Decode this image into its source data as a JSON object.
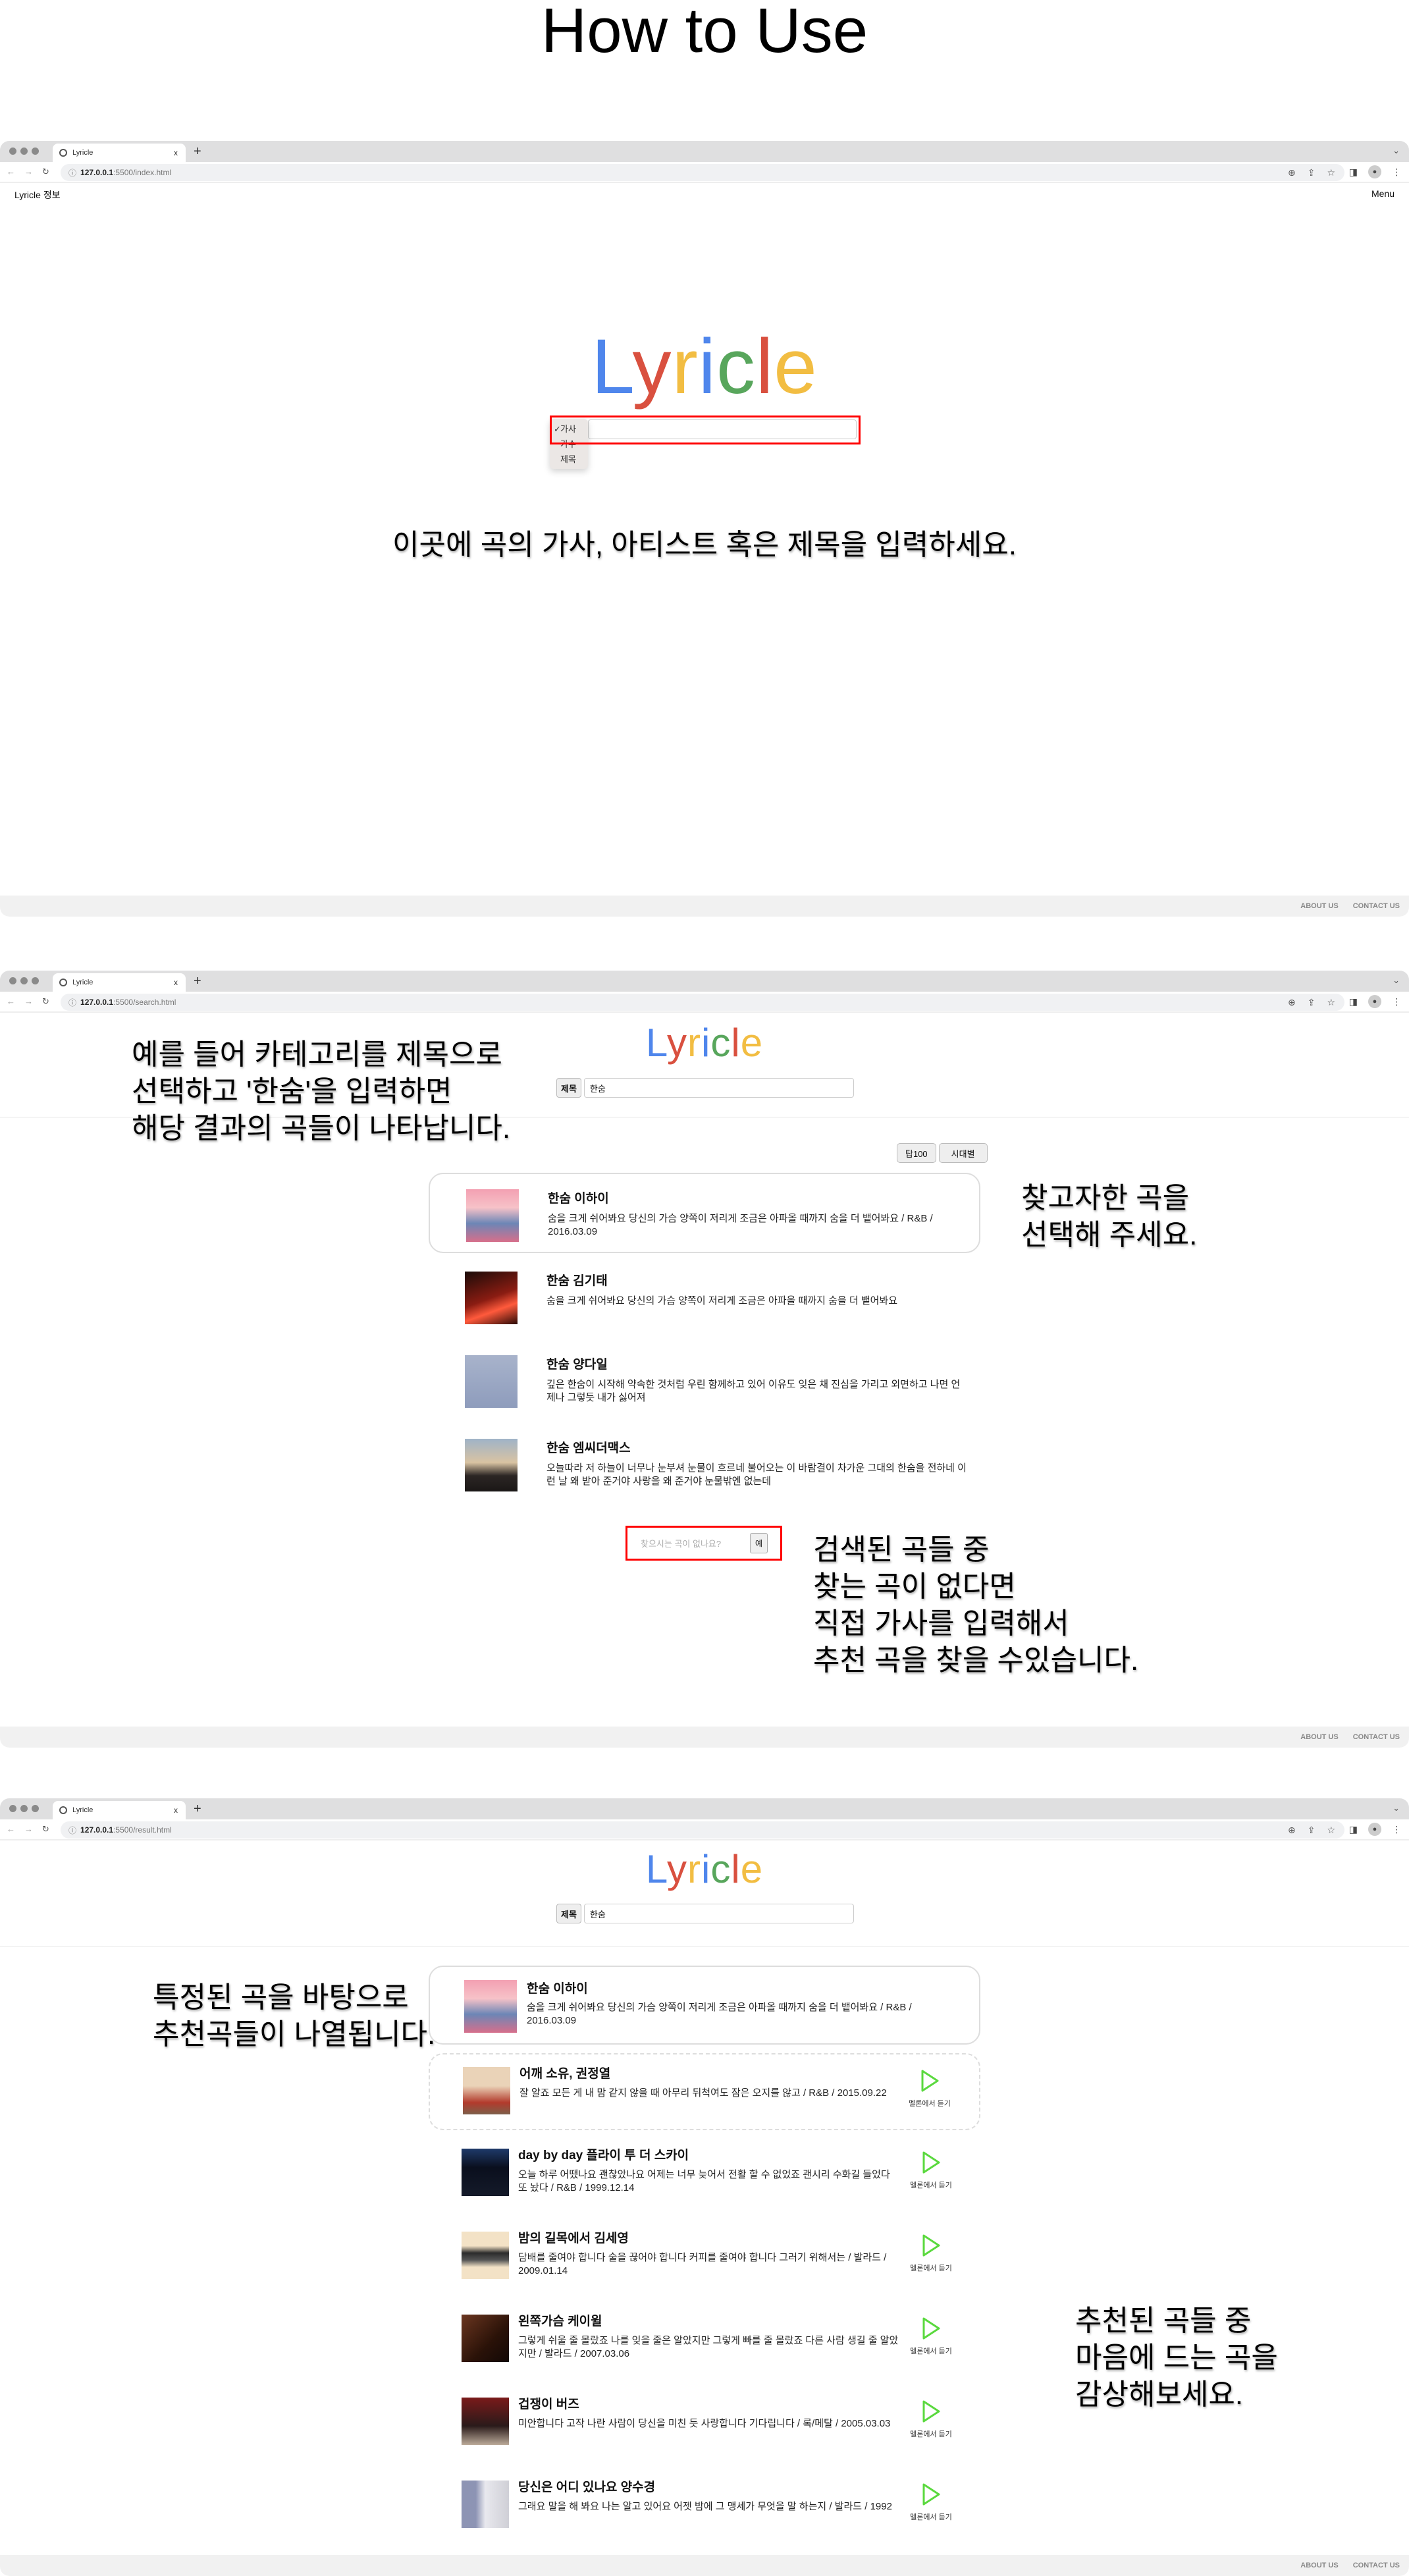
{
  "heading": "How to Use",
  "browser": {
    "tab_title": "Lyricle",
    "close": "x",
    "new_tab": "+",
    "url_host": "127.0.0.1",
    "icons": [
      "back-icon",
      "forward-icon",
      "reload-icon",
      "info-icon",
      "zoom-icon",
      "share-icon",
      "star-icon",
      "media-icon",
      "sidebar-icon",
      "profile-icon",
      "kebab-icon"
    ]
  },
  "site": {
    "nav_left": "Lyricle 정보",
    "nav_right": "Menu",
    "logo_letters": [
      "L",
      "y",
      "r",
      "i",
      "c",
      "l",
      "e"
    ],
    "footer": [
      "ABOUT US",
      "CONTACT US"
    ],
    "colors": {
      "blue": "#4f86ec",
      "red": "#d9503f",
      "yellow": "#f2bd42",
      "green": "#58a65c",
      "melon": "#5ad93e",
      "highlight": "#ff0000"
    }
  },
  "page1": {
    "url_path": ":5500/index.html",
    "dropdown": [
      {
        "label": "가사",
        "checked": true
      },
      {
        "label": "가수",
        "checked": false
      },
      {
        "label": "제목",
        "checked": false
      }
    ],
    "check": "✓",
    "caption": "이곳에 곡의 가사, 아티스트 혹은 제목을 입력하세요."
  },
  "page2": {
    "url_path": ":5500/search.html",
    "category": "제목",
    "query": "한숨",
    "filters": [
      "탑100",
      "시대별"
    ],
    "results": [
      {
        "title": "한숨 이하이",
        "desc": "숨을 크게 쉬어봐요 당신의 가슴 양쪽이 저리게 조금은 아파올 때까지 숨을 더 뱉어봐요 / R&B / 2016.03.09"
      },
      {
        "title": "한숨 김기태",
        "desc": "숨을 크게 쉬어봐요 당신의 가슴 양쪽이 저리게 조금은 아파올 때까지 숨을 더 뱉어봐요"
      },
      {
        "title": "한숨 양다일",
        "desc": "깊은 한숨이 시작해 약속한 것처럼 우린 함께하고 있어 이유도 잊은 채 진심을 가리고 외면하고 나면 언제나 그렇듯 내가 싫어져"
      },
      {
        "title": "한숨 엠씨더맥스",
        "desc": "오늘따라 저 하늘이 너무나 눈부셔 눈물이 흐르네 불어오는 이 바람결이 차가운 그대의 한숨을 전하네 이런 날 왜 받아 준거야 사랑을 왜 준거야 눈물밖엔 없는데"
      }
    ],
    "no_song_placeholder": "찾으시는 곡이 없나요?",
    "no_song_button": "예",
    "annot_left": "예를 들어 카테고리를 제목으로\n선택하고 '한숨'을 입력하면\n해당 결과의 곡들이 나타납니다.",
    "annot_right": "찾고자한 곡을\n선택해 주세요.",
    "annot_bottom": "검색된 곡들 중\n찾는 곡이 없다면\n직접 가사를 입력해서\n추천 곡을 찾을 수있습니다."
  },
  "page3": {
    "url_path": ":5500/result.html",
    "category": "제목",
    "query": "한숨",
    "selected": {
      "title": "한숨 이하이",
      "desc": "숨을 크게 쉬어봐요 당신의 가슴 양쪽이 저리게 조금은 아파올 때까지 숨을 더 뱉어봐요 / R&B / 2016.03.09"
    },
    "listen_label": "멜론에서 듣기",
    "recommendations": [
      {
        "title": "어깨 소유, 권정열",
        "desc": "잘 알죠 모든 게 내 맘 같지 않을 때 아무리 뒤척여도 잠은 오지를 않고 / R&B / 2015.09.22"
      },
      {
        "title": "day by day 플라이 투 더 스카이",
        "desc": "오늘 하루 어땠나요 괜찮았나요 어제는 너무 늦어서 전활 할 수 없었죠 괜시리 수화길 들었다 또 놨다 / R&B / 1999.12.14"
      },
      {
        "title": "밤의 길목에서 김세영",
        "desc": "담배를 줄여야 합니다 술을 끊어야 합니다 커피를 줄여야 합니다 그러기 위해서는 / 발라드 / 2009.01.14"
      },
      {
        "title": "왼쪽가슴 케이윌",
        "desc": "그렇게 쉬울 줄 몰랐죠 나를 잊을 줄은 알았지만 그렇게 빠를 줄 몰랐죠 다른 사람 생길 줄 알았지만 / 발라드 / 2007.03.06"
      },
      {
        "title": "겁쟁이 버즈",
        "desc": "미안합니다 고작 나란 사람이 당신을 미친 듯 사랑합니다 기다립니다 / 록/메탈 / 2005.03.03"
      },
      {
        "title": "당신은 어디 있나요 양수경",
        "desc": "그래요 말을 해 봐요 나는 알고 있어요 어젯 밤에 그 맹세가 무엇을 말 하는지 / 발라드 / 1992"
      }
    ],
    "annot_left": "특정된 곡을 바탕으로\n추천곡들이 나열됩니다.",
    "annot_right": "추천된 곡들 중\n마음에 드는 곡을\n감상해보세요."
  }
}
